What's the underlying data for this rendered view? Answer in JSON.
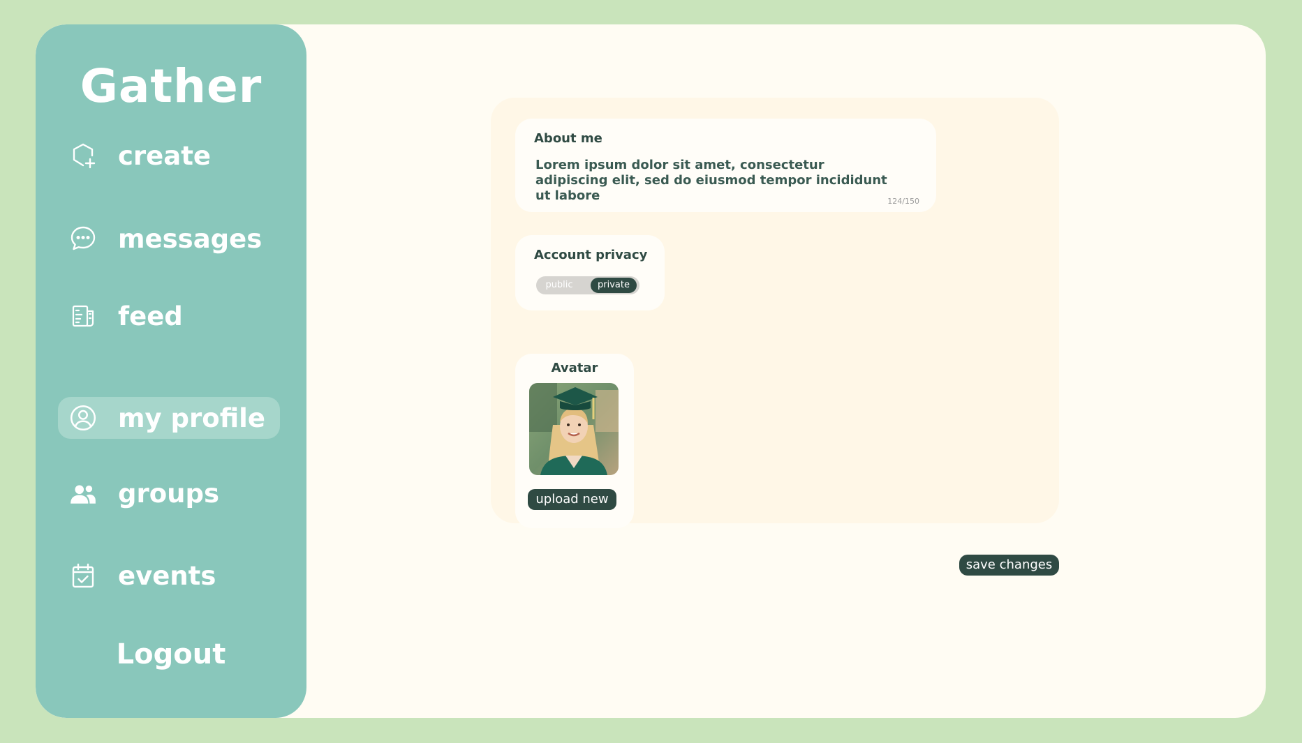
{
  "app": {
    "name": "Gather"
  },
  "sidebar": {
    "items": [
      {
        "label": "create",
        "icon": "hexagon-plus-icon",
        "active": false
      },
      {
        "label": "messages",
        "icon": "chat-bubble-icon",
        "active": false
      },
      {
        "label": "feed",
        "icon": "newspaper-icon",
        "active": false
      },
      {
        "label": "my profile",
        "icon": "user-circle-icon",
        "active": true
      },
      {
        "label": "groups",
        "icon": "users-icon",
        "active": false
      },
      {
        "label": "events",
        "icon": "calendar-check-icon",
        "active": false
      }
    ],
    "logout_label": "Logout"
  },
  "profile": {
    "about": {
      "title": "About me",
      "text": "Lorem ipsum dolor sit amet, consectetur adipiscing elit, sed do eiusmod tempor incididunt ut labore",
      "counter": "124/150"
    },
    "privacy": {
      "title": "Account privacy",
      "options": [
        "public",
        "private"
      ],
      "selected": "private"
    },
    "avatar": {
      "title": "Avatar",
      "upload_label": "upload new"
    }
  },
  "actions": {
    "save_label": "save changes"
  },
  "colors": {
    "background": "#c9e4bb",
    "sidebar": "#89c7bb",
    "content": "#fffcf3",
    "panel": "#fff7e7",
    "button": "#2f4a43"
  }
}
